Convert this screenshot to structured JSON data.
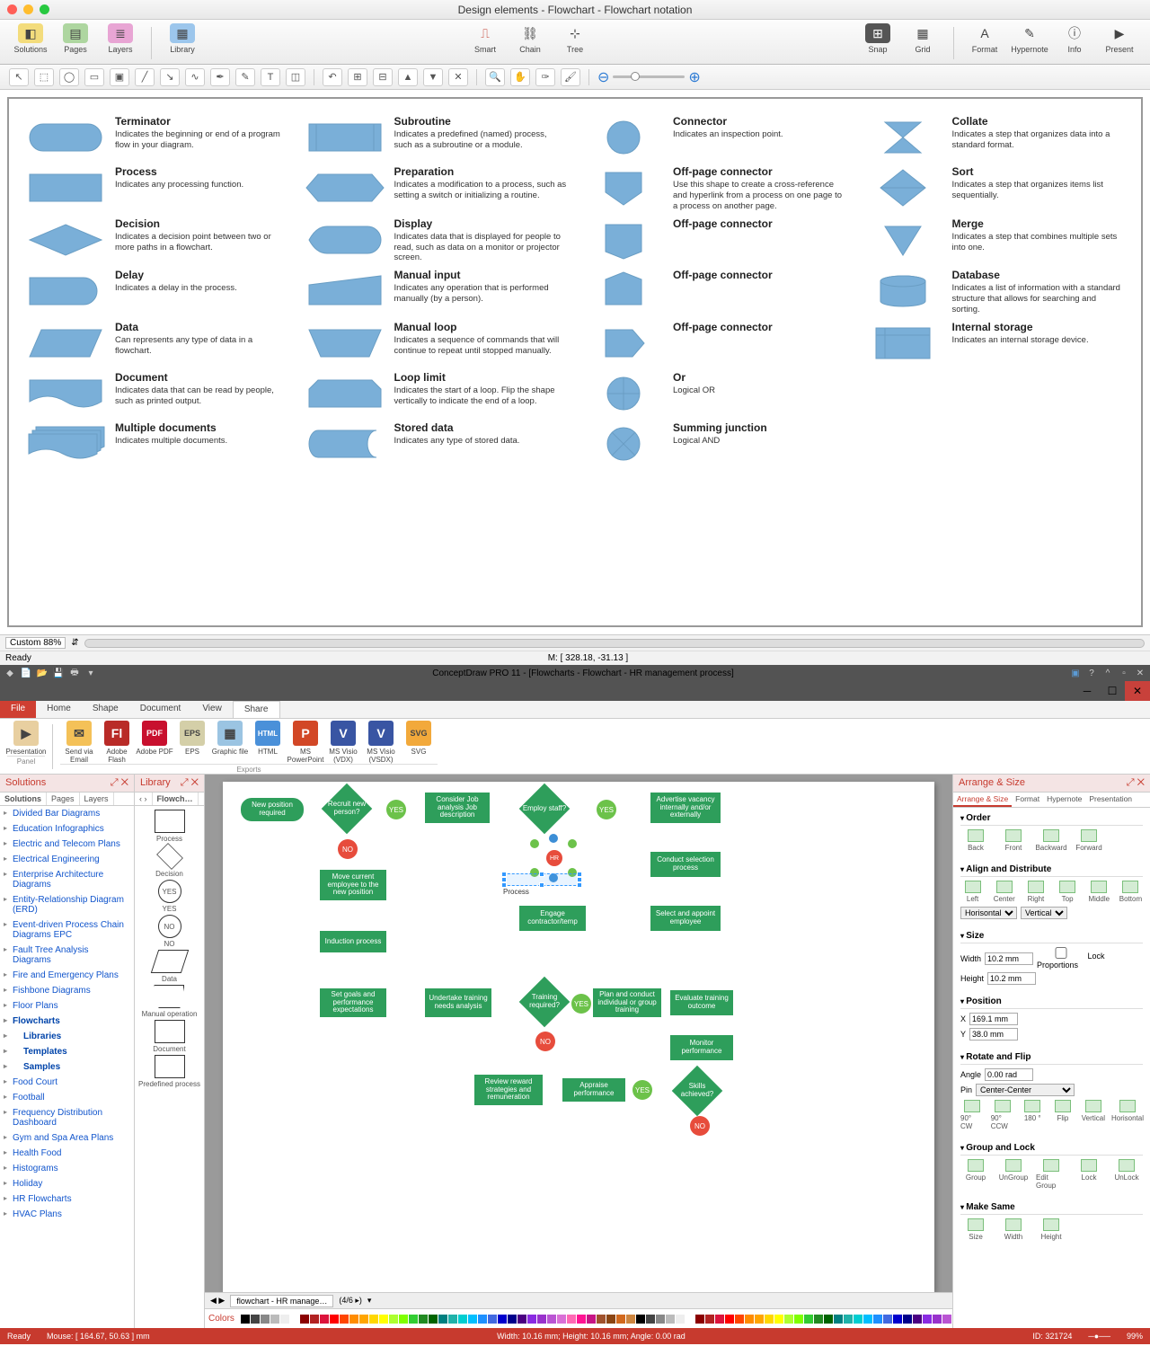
{
  "mac": {
    "title": "Design elements - Flowchart - Flowchart notation",
    "toolbar": {
      "solutions": "Solutions",
      "pages": "Pages",
      "layers": "Layers",
      "library": "Library",
      "smart": "Smart",
      "chain": "Chain",
      "tree": "Tree",
      "snap": "Snap",
      "grid": "Grid",
      "format": "Format",
      "hypernote": "Hypernote",
      "info": "Info",
      "present": "Present"
    },
    "zoom": "Custom 88%",
    "ready": "Ready",
    "coords": "M: [ 328.18, -31.13 ]"
  },
  "defs": [
    {
      "t": "Terminator",
      "d": "Indicates the beginning or end of a program flow in your diagram."
    },
    {
      "t": "Subroutine",
      "d": "Indicates a predefined (named) process, such as a subroutine or a module."
    },
    {
      "t": "Connector",
      "d": "Indicates an inspection point."
    },
    {
      "t": "Collate",
      "d": "Indicates a step that organizes data into a standard format."
    },
    {
      "t": "Process",
      "d": "Indicates any processing function."
    },
    {
      "t": "Preparation",
      "d": "Indicates a modification to a process, such as setting a switch or initializing a routine."
    },
    {
      "t": "Off-page connector",
      "d": "Use this shape to create a cross-reference and hyperlink from a process on one page to a process on another page."
    },
    {
      "t": "Sort",
      "d": "Indicates a step that organizes items list sequentially."
    },
    {
      "t": "Decision",
      "d": "Indicates a decision point between two or more paths in a flowchart."
    },
    {
      "t": "Display",
      "d": "Indicates data that is displayed for people to read, such as data on a monitor or projector screen."
    },
    {
      "t": "Off-page connector",
      "d": ""
    },
    {
      "t": "Merge",
      "d": "Indicates a step that combines multiple sets into one."
    },
    {
      "t": "Delay",
      "d": "Indicates a delay in the process."
    },
    {
      "t": "Manual input",
      "d": "Indicates any operation that is performed manually (by a person)."
    },
    {
      "t": "Off-page connector",
      "d": ""
    },
    {
      "t": "Database",
      "d": "Indicates a list of information with a standard structure that allows for searching and sorting."
    },
    {
      "t": "Data",
      "d": "Can represents any type of data in a flowchart."
    },
    {
      "t": "Manual loop",
      "d": "Indicates a sequence of commands that will continue to repeat until stopped manually."
    },
    {
      "t": "Off-page connector",
      "d": ""
    },
    {
      "t": "Internal storage",
      "d": "Indicates an internal storage device."
    },
    {
      "t": "Document",
      "d": "Indicates data that can be read by people, such as printed output."
    },
    {
      "t": "Loop limit",
      "d": "Indicates the start of a loop. Flip the shape vertically to indicate the end of a loop."
    },
    {
      "t": "Or",
      "d": "Logical OR"
    },
    {
      "t": "",
      "d": ""
    },
    {
      "t": "Multiple documents",
      "d": "Indicates multiple documents."
    },
    {
      "t": "Stored data",
      "d": "Indicates any type of stored data."
    },
    {
      "t": "Summing junction",
      "d": "Logical AND"
    },
    {
      "t": "",
      "d": ""
    }
  ],
  "win": {
    "title": "ConceptDraw PRO 11 - [Flowcharts - Flowchart - HR management process]",
    "tabs": {
      "file": "File",
      "home": "Home",
      "shape": "Shape",
      "document": "Document",
      "view": "View",
      "share": "Share"
    },
    "ribbon": {
      "presentation": "Presentation",
      "sendemail": "Send via Email",
      "adobeflash": "Adobe Flash",
      "adobepdf": "Adobe PDF",
      "eps": "EPS",
      "graphicfile": "Graphic file",
      "html": "HTML",
      "mspowerpoint": "MS PowerPoint",
      "msvisiovdx": "MS Visio (VDX)",
      "msvisiovsdx": "MS Visio (VSDX)",
      "svg": "SVG",
      "panel": "Panel",
      "exports": "Exports"
    },
    "panels": {
      "solutions": "Solutions",
      "library": "Library",
      "arrange": "Arrange & Size",
      "colors": "Colors"
    },
    "ptabs": {
      "solutions": "Solutions",
      "pages": "Pages",
      "layers": "Layers"
    },
    "libtab": "Flowch…",
    "sol": [
      "Divided Bar Diagrams",
      "Education Infographics",
      "Electric and Telecom Plans",
      "Electrical Engineering",
      "Enterprise Architecture Diagrams",
      "Entity-Relationship Diagram (ERD)",
      "Event-driven Process Chain Diagrams EPC",
      "Fault Tree Analysis Diagrams",
      "Fire and Emergency Plans",
      "Fishbone Diagrams",
      "Floor Plans",
      "Flowcharts",
      "Food Court",
      "Football",
      "Frequency Distribution Dashboard",
      "Gym and Spa Area Plans",
      "Health Food",
      "Histograms",
      "Holiday",
      "HR Flowcharts",
      "HVAC Plans"
    ],
    "solsub": [
      "Libraries",
      "Templates",
      "Samples"
    ],
    "lib": [
      "Process",
      "Decision",
      "YES",
      "NO",
      "Data",
      "Manual operation",
      "Document",
      "Predefined process"
    ],
    "nodes": {
      "newpos": "New position required",
      "recruit": "Recruit new person?",
      "consider": "Consider Job analysis Job description",
      "employ": "Employ staff?",
      "advertise": "Advertise vacancy internally and/or externally",
      "movecur": "Move current employee to the new position",
      "conduct": "Conduct selection process",
      "engage": "Engage contractor/temp",
      "select": "Select and appoint employee",
      "induction": "Induction process",
      "setgoals": "Set goals and performance expectations",
      "undertake": "Undertake training needs analysis",
      "training": "Training required?",
      "planconduct": "Plan and conduct individual or group training",
      "evaluate": "Evaluate training outcome",
      "monitor": "Monitor performance",
      "review": "Review reward strategies and remuneration",
      "appraise": "Appraise performance",
      "skills": "Skills achieved?",
      "yes": "YES",
      "no": "NO",
      "proclbl": "Process",
      "hr": "HR"
    },
    "sheet": {
      "tab": "flowchart - HR manage…",
      "pages": "(4/6 ▸)"
    },
    "arrange": {
      "tabs": [
        "Arrange & Size",
        "Format",
        "Hypernote",
        "Presentation"
      ],
      "order": "Order",
      "orderbtns": [
        "Back",
        "Front",
        "Backward",
        "Forward"
      ],
      "align": "Align and Distribute",
      "alignbtns": [
        "Left",
        "Center",
        "Right",
        "Top",
        "Middle",
        "Bottom"
      ],
      "horiz": "Horisontal",
      "vert": "Vertical",
      "size": "Size",
      "width": "Width",
      "widthv": "10.2 mm",
      "height": "Height",
      "heightv": "10.2 mm",
      "lock": "Lock Proportions",
      "position": "Position",
      "x": "X",
      "xv": "169.1 mm",
      "y": "Y",
      "yv": "38.0 mm",
      "rotate": "Rotate and Flip",
      "angle": "Angle",
      "anglev": "0.00 rad",
      "pin": "Pin",
      "pinv": "Center-Center",
      "rotbtns": [
        "90° CW",
        "90° CCW",
        "180 °",
        "Flip",
        "Vertical",
        "Horisontal"
      ],
      "group": "Group and Lock",
      "groupbtns": [
        "Group",
        "UnGroup",
        "Edit Group",
        "Lock",
        "UnLock"
      ],
      "make": "Make Same",
      "makebtns": [
        "Size",
        "Width",
        "Height"
      ]
    },
    "status": {
      "ready": "Ready",
      "mouse": "Mouse: [ 164.67, 50.63 ] mm",
      "dims": "Width: 10.16 mm;   Height: 10.16 mm;   Angle: 0.00 rad",
      "id": "ID: 321724",
      "zoom": "99%"
    }
  }
}
